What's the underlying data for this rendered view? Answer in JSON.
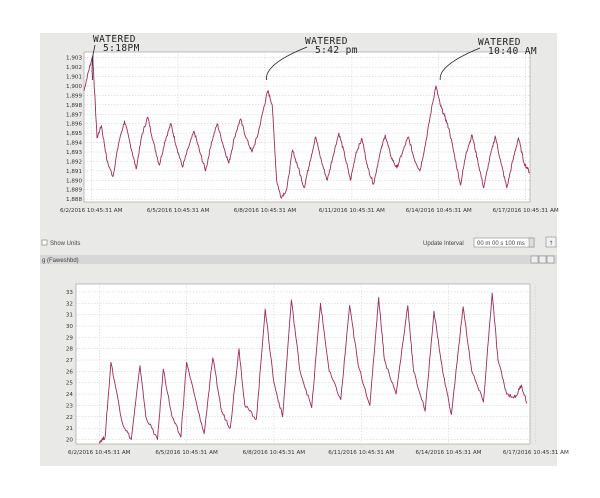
{
  "window": {
    "show_units_label": "Show Units",
    "update_interval_label": "Update Interval",
    "update_interval_value": "00 m 00 s 100 ms",
    "lower_window_title": "g (Faweshbd)"
  },
  "colors": {
    "trace": "#9b2e5a",
    "grid": "#bdbdbd",
    "panel": "#ffffff",
    "chrome": "#e9e9e7"
  },
  "chart_data": [
    {
      "type": "line",
      "title": "",
      "xlabel": "",
      "ylabel": "",
      "ylim": [
        1887.7,
        1903.6
      ],
      "y_ticks": [
        "1,903",
        "1,902",
        "1,901",
        "1,900",
        "1,899",
        "1,898",
        "1,897",
        "1,896",
        "1,895",
        "1,894",
        "1,893",
        "1,892",
        "1,891",
        "1,890",
        "1,889",
        "1,888"
      ],
      "x_ticks": [
        "6/2/2016 10:45:31 AM",
        "6/5/2016 10:45:31 AM",
        "6/8/2016 10:45:31 AM",
        "6/11/2016 10:45:31 AM",
        "6/14/2016 10:45:31 AM",
        "6/17/2016 10:45:31 AM"
      ],
      "x_range_days": [
        0,
        15.4
      ],
      "grid": true,
      "annotations": [
        {
          "text": "WATERED",
          "text2": "5:18PM",
          "x_day": 0.3
        },
        {
          "text": "WATERED",
          "text2": "5:42 pm",
          "x_day": 6.3
        },
        {
          "text": "WATERED",
          "text2": "10:40 AM",
          "x_day": 12.3
        }
      ],
      "series": [
        {
          "x": [
            0,
            0.15,
            0.3,
            0.45,
            0.6,
            0.8,
            1,
            1.2,
            1.4,
            1.6,
            1.8,
            2,
            2.2,
            2.4,
            2.6,
            2.8,
            3,
            3.2,
            3.4,
            3.6,
            3.8,
            4,
            4.2,
            4.4,
            4.6,
            4.8,
            5,
            5.2,
            5.4,
            5.6,
            5.8,
            6,
            6.2,
            6.35,
            6.5,
            6.65,
            6.8,
            7,
            7.2,
            7.4,
            7.6,
            7.8,
            8,
            8.2,
            8.4,
            8.6,
            8.8,
            9,
            9.2,
            9.4,
            9.6,
            9.8,
            10,
            10.2,
            10.4,
            10.6,
            10.8,
            11,
            11.2,
            11.4,
            11.6,
            11.8,
            12,
            12.15,
            12.3,
            12.45,
            12.6,
            12.8,
            13,
            13.2,
            13.4,
            13.6,
            13.8,
            14,
            14.2,
            14.4,
            14.6,
            14.8,
            15,
            15.2,
            15.4
          ],
          "values": [
            1899.5,
            1901.5,
            1903.2,
            1894.5,
            1895.8,
            1892,
            1890.4,
            1894,
            1896.3,
            1893.8,
            1891.2,
            1894.8,
            1896.7,
            1894,
            1891.6,
            1894.2,
            1896,
            1893.5,
            1891.4,
            1893.4,
            1895.2,
            1893,
            1891,
            1894,
            1896,
            1893.8,
            1891.8,
            1894.6,
            1896.5,
            1894.5,
            1893,
            1894.8,
            1897.6,
            1899.5,
            1898,
            1890,
            1888.2,
            1889,
            1893.2,
            1891.3,
            1889.2,
            1892,
            1894.6,
            1892,
            1890,
            1892.6,
            1895,
            1892.7,
            1890,
            1893,
            1894.4,
            1891.3,
            1889.6,
            1892.6,
            1894.8,
            1892.5,
            1891.3,
            1893,
            1894.6,
            1892.3,
            1891,
            1894,
            1897.6,
            1900,
            1898,
            1896.8,
            1895.5,
            1892.5,
            1889.5,
            1893,
            1894.8,
            1892,
            1889.2,
            1892.2,
            1894.7,
            1891.8,
            1889.2,
            1892,
            1894.5,
            1891.8,
            1890.8
          ]
        }
      ]
    },
    {
      "type": "line",
      "title": "",
      "xlabel": "",
      "ylabel": "",
      "ylim": [
        19.6,
        33.7
      ],
      "y_ticks": [
        "33",
        "32",
        "31",
        "30",
        "29",
        "28",
        "27",
        "26",
        "25",
        "24",
        "23",
        "22",
        "21",
        "20"
      ],
      "x_ticks": [
        "6/2/2016 10:45:31 AM",
        "6/5/2016 10:45:31 AM",
        "6/8/2016 10:45:31 AM",
        "6/11/2016 10:45:31 AM",
        "6/14/2016 10:45:31 AM",
        "6/17/2016 10:45:31 AM"
      ],
      "x_range_days": [
        0,
        15.6
      ],
      "grid": true,
      "series": [
        {
          "x": [
            0.8,
            1.0,
            1.2,
            1.6,
            1.9,
            2.2,
            2.4,
            2.8,
            3.0,
            3.3,
            3.6,
            3.8,
            4.2,
            4.4,
            4.7,
            5.0,
            5.3,
            5.6,
            5.8,
            6.2,
            6.5,
            6.8,
            7.1,
            7.4,
            7.7,
            8.1,
            8.4,
            8.7,
            9.1,
            9.4,
            9.7,
            10.1,
            10.4,
            10.6,
            11.0,
            11.4,
            11.6,
            12.0,
            12.3,
            12.6,
            12.9,
            13.3,
            13.6,
            14.0,
            14.3,
            14.5,
            14.8,
            15.1,
            15.3,
            15.5
          ],
          "values": [
            19.8,
            20.2,
            26.8,
            21.4,
            20,
            26.5,
            22,
            20,
            26.2,
            22,
            20.2,
            26.8,
            22.5,
            20.5,
            27.2,
            22.5,
            21,
            28,
            23,
            21.8,
            31.5,
            25,
            22,
            32.3,
            26,
            22.8,
            32,
            26,
            23.5,
            31.8,
            26.5,
            23,
            32.5,
            27,
            24,
            31.8,
            26,
            22.5,
            31.3,
            26,
            22.2,
            31.7,
            26,
            23.3,
            32.9,
            27,
            24,
            23.7,
            24.8,
            23.2
          ]
        }
      ]
    }
  ]
}
